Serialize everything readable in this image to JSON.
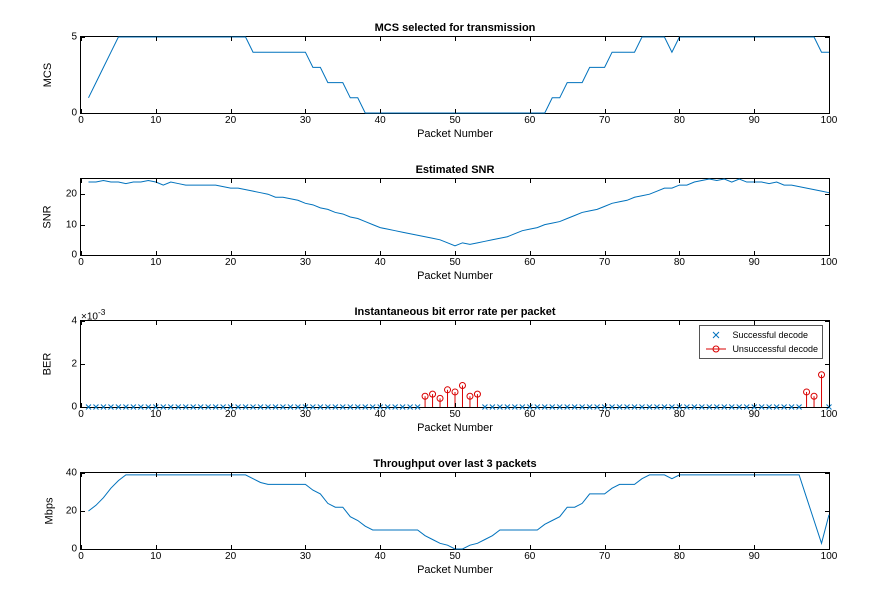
{
  "chart_data": [
    {
      "type": "line",
      "title": "MCS selected for transmission",
      "xlabel": "Packet Number",
      "ylabel": "MCS",
      "xlim": [
        0,
        100
      ],
      "ylim": [
        0,
        5
      ],
      "yticks": [
        0,
        5
      ],
      "xticks": [
        0,
        10,
        20,
        30,
        40,
        50,
        60,
        70,
        80,
        90,
        100
      ],
      "x": [
        1,
        2,
        3,
        4,
        5,
        6,
        7,
        8,
        9,
        10,
        11,
        12,
        13,
        14,
        15,
        16,
        17,
        18,
        19,
        20,
        21,
        22,
        23,
        24,
        25,
        26,
        27,
        28,
        29,
        30,
        31,
        32,
        33,
        34,
        35,
        36,
        37,
        38,
        39,
        40,
        41,
        42,
        43,
        44,
        45,
        46,
        47,
        48,
        49,
        50,
        51,
        52,
        53,
        54,
        55,
        56,
        57,
        58,
        59,
        60,
        61,
        62,
        63,
        64,
        65,
        66,
        67,
        68,
        69,
        70,
        71,
        72,
        73,
        74,
        75,
        76,
        77,
        78,
        79,
        80,
        81,
        82,
        83,
        84,
        85,
        86,
        87,
        88,
        89,
        90,
        91,
        92,
        93,
        94,
        95,
        96,
        97,
        98,
        99,
        100
      ],
      "y": [
        1,
        2,
        3,
        4,
        5,
        5,
        5,
        5,
        5,
        5,
        5,
        5,
        5,
        5,
        5,
        5,
        5,
        5,
        5,
        5,
        5,
        5,
        4,
        4,
        4,
        4,
        4,
        4,
        4,
        4,
        3,
        3,
        2,
        2,
        2,
        1,
        1,
        0,
        0,
        0,
        0,
        0,
        0,
        0,
        0,
        0,
        0,
        0,
        0,
        0,
        0,
        0,
        0,
        0,
        0,
        0,
        0,
        0,
        0,
        0,
        0,
        0,
        1,
        1,
        2,
        2,
        2,
        3,
        3,
        3,
        4,
        4,
        4,
        4,
        5,
        5,
        5,
        5,
        4,
        5,
        5,
        5,
        5,
        5,
        5,
        5,
        5,
        5,
        5,
        5,
        5,
        5,
        5,
        5,
        5,
        5,
        5,
        5,
        4,
        4
      ]
    },
    {
      "type": "line",
      "title": "Estimated SNR",
      "xlabel": "Packet Number",
      "ylabel": "SNR",
      "xlim": [
        0,
        100
      ],
      "ylim": [
        0,
        25
      ],
      "yticks": [
        0,
        10,
        20
      ],
      "xticks": [
        0,
        10,
        20,
        30,
        40,
        50,
        60,
        70,
        80,
        90,
        100
      ],
      "x": [
        1,
        2,
        3,
        4,
        5,
        6,
        7,
        8,
        9,
        10,
        11,
        12,
        13,
        14,
        15,
        16,
        17,
        18,
        19,
        20,
        21,
        22,
        23,
        24,
        25,
        26,
        27,
        28,
        29,
        30,
        31,
        32,
        33,
        34,
        35,
        36,
        37,
        38,
        39,
        40,
        41,
        42,
        43,
        44,
        45,
        46,
        47,
        48,
        49,
        50,
        51,
        52,
        53,
        54,
        55,
        56,
        57,
        58,
        59,
        60,
        61,
        62,
        63,
        64,
        65,
        66,
        67,
        68,
        69,
        70,
        71,
        72,
        73,
        74,
        75,
        76,
        77,
        78,
        79,
        80,
        81,
        82,
        83,
        84,
        85,
        86,
        87,
        88,
        89,
        90,
        91,
        92,
        93,
        94,
        95,
        96,
        97,
        98,
        99,
        100
      ],
      "y": [
        24,
        24,
        24.5,
        24,
        24,
        23.5,
        24,
        24,
        24.5,
        24,
        23,
        24,
        23.5,
        23,
        23,
        23,
        23,
        23,
        22.5,
        22,
        22,
        21.5,
        21,
        20.5,
        20,
        19,
        19,
        18.5,
        18,
        17,
        16.5,
        15.5,
        15,
        14,
        13.5,
        12.5,
        12,
        11,
        10,
        9,
        8.5,
        8,
        7.5,
        7,
        6.5,
        6,
        5.5,
        5,
        4,
        3,
        4,
        3.5,
        4,
        4.5,
        5,
        5.5,
        6,
        7,
        8,
        8.5,
        9,
        10,
        10.5,
        11,
        12,
        13,
        14,
        14.5,
        15,
        16,
        17,
        17.5,
        18,
        19,
        19.5,
        20,
        21,
        22,
        22,
        23,
        23,
        24,
        24.5,
        25,
        24.5,
        25,
        24,
        25,
        24,
        24,
        24,
        23.5,
        24,
        23,
        23,
        22.5,
        22,
        21.5,
        21,
        20.5
      ]
    },
    {
      "type": "scatter",
      "title": "Instantaneous bit error rate per packet",
      "xlabel": "Packet Number",
      "ylabel": "BER",
      "xlim": [
        0,
        100
      ],
      "ylim": [
        0,
        0.004
      ],
      "yexponent": "×10",
      "yexponent_sup": "-3",
      "yticks_display": [
        0,
        2,
        4
      ],
      "yticks": [
        0,
        0.002,
        0.004
      ],
      "xticks": [
        0,
        10,
        20,
        30,
        40,
        50,
        60,
        70,
        80,
        90,
        100
      ],
      "legend": [
        {
          "label": "Successful decode",
          "marker": "x",
          "color": "#0072BD"
        },
        {
          "label": "Unsuccessful decode",
          "marker": "stem-o",
          "color": "#D90000"
        }
      ],
      "series": [
        {
          "name": "Successful decode",
          "marker": "x",
          "x": [
            1,
            2,
            3,
            4,
            5,
            6,
            7,
            8,
            9,
            10,
            11,
            12,
            13,
            14,
            15,
            16,
            17,
            18,
            19,
            20,
            21,
            22,
            23,
            24,
            25,
            26,
            27,
            28,
            29,
            30,
            31,
            32,
            33,
            34,
            35,
            36,
            37,
            38,
            39,
            40,
            41,
            42,
            43,
            44,
            45,
            54,
            55,
            56,
            57,
            58,
            59,
            60,
            61,
            62,
            63,
            64,
            65,
            66,
            67,
            68,
            69,
            70,
            71,
            72,
            73,
            74,
            75,
            76,
            77,
            78,
            79,
            80,
            81,
            82,
            83,
            84,
            85,
            86,
            87,
            88,
            89,
            90,
            91,
            92,
            93,
            94,
            95,
            96,
            100
          ],
          "y": [
            0,
            0,
            0,
            0,
            0,
            0,
            0,
            0,
            0,
            0,
            0,
            0,
            0,
            0,
            0,
            0,
            0,
            0,
            0,
            0,
            0,
            0,
            0,
            0,
            0,
            0,
            0,
            0,
            0,
            0,
            0,
            0,
            0,
            0,
            0,
            0,
            0,
            0,
            0,
            0,
            0,
            0,
            0,
            0,
            0,
            0,
            0,
            0,
            0,
            0,
            0,
            0,
            0,
            0,
            0,
            0,
            0,
            0,
            0,
            0,
            0,
            0,
            0,
            0,
            0,
            0,
            0,
            0,
            0,
            0,
            0,
            0,
            0,
            0,
            0,
            0,
            0,
            0,
            0,
            0,
            0,
            0,
            0,
            0,
            0,
            0,
            0,
            0,
            0
          ]
        },
        {
          "name": "Unsuccessful decode",
          "marker": "stem-o",
          "x": [
            46,
            47,
            48,
            49,
            50,
            51,
            52,
            53,
            97,
            98,
            99
          ],
          "y": [
            0.0005,
            0.0006,
            0.0004,
            0.0008,
            0.0007,
            0.001,
            0.0005,
            0.0006,
            0.0007,
            0.0005,
            0.0015
          ]
        }
      ]
    },
    {
      "type": "line",
      "title": "Throughput over last 3 packets",
      "xlabel": "Packet Number",
      "ylabel": "Mbps",
      "xlim": [
        0,
        100
      ],
      "ylim": [
        0,
        40
      ],
      "yticks": [
        0,
        20,
        40
      ],
      "xticks": [
        0,
        10,
        20,
        30,
        40,
        50,
        60,
        70,
        80,
        90,
        100
      ],
      "x": [
        1,
        2,
        3,
        4,
        5,
        6,
        7,
        8,
        9,
        10,
        11,
        12,
        13,
        14,
        15,
        16,
        17,
        18,
        19,
        20,
        21,
        22,
        23,
        24,
        25,
        26,
        27,
        28,
        29,
        30,
        31,
        32,
        33,
        34,
        35,
        36,
        37,
        38,
        39,
        40,
        41,
        42,
        43,
        44,
        45,
        46,
        47,
        48,
        49,
        50,
        51,
        52,
        53,
        54,
        55,
        56,
        57,
        58,
        59,
        60,
        61,
        62,
        63,
        64,
        65,
        66,
        67,
        68,
        69,
        70,
        71,
        72,
        73,
        74,
        75,
        76,
        77,
        78,
        79,
        80,
        81,
        82,
        83,
        84,
        85,
        86,
        87,
        88,
        89,
        90,
        91,
        92,
        93,
        94,
        95,
        96,
        97,
        98,
        99,
        100
      ],
      "y": [
        20,
        23,
        27,
        32,
        36,
        39,
        39,
        39,
        39,
        39,
        39,
        39,
        39,
        39,
        39,
        39,
        39,
        39,
        39,
        39,
        39,
        39,
        37,
        35,
        34,
        34,
        34,
        34,
        34,
        34,
        31,
        29,
        24,
        22,
        22,
        17,
        15,
        12,
        10,
        10,
        10,
        10,
        10,
        10,
        10,
        7,
        5,
        3,
        2,
        0,
        0,
        2,
        3,
        5,
        7,
        10,
        10,
        10,
        10,
        10,
        10,
        13,
        15,
        17,
        22,
        22,
        24,
        29,
        29,
        29,
        32,
        34,
        34,
        34,
        37,
        39,
        39,
        39,
        37,
        39,
        39,
        39,
        39,
        39,
        39,
        39,
        39,
        39,
        39,
        39,
        39,
        39,
        39,
        39,
        39,
        39,
        27,
        15,
        3,
        18
      ]
    }
  ]
}
